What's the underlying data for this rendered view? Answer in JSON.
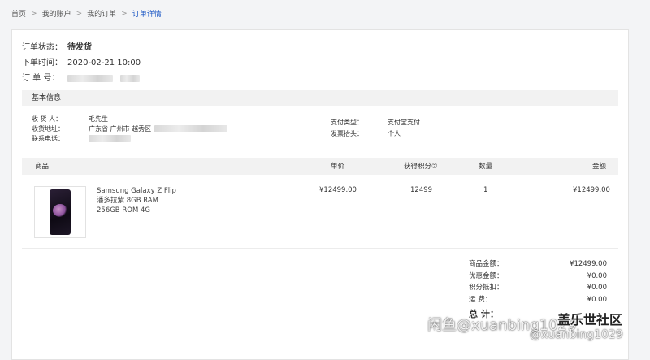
{
  "breadcrumb": {
    "items": [
      "首页",
      "我的账户",
      "我的订单"
    ],
    "current": "订单详情",
    "separator": ">"
  },
  "order": {
    "status_label": "订单状态：",
    "status_value": "待发货",
    "time_label": "下单时间：",
    "time_value": "2020-02-21 10:00",
    "number_label": "订 单 号："
  },
  "basic_info": {
    "title": "基本信息",
    "receiver_label": "收 货 人：",
    "receiver_value": "毛先生",
    "address_label": "收货地址：",
    "address_value": "广东省   广州市   越秀区",
    "phone_label": "联系电话：",
    "pay_type_label": "支付类型：",
    "pay_type_value": "支付宝支付",
    "invoice_label": "发票抬头：",
    "invoice_value": "个人"
  },
  "goods_table": {
    "headers": {
      "product": "商品",
      "price": "单价",
      "points": "获得积分⑦",
      "qty": "数量",
      "amount": "金额"
    },
    "item": {
      "name": "Samsung Galaxy Z Flip",
      "spec1": "潘多拉紫   8GB RAM",
      "spec2": "256GB ROM   4G",
      "price": "¥12499.00",
      "points": "12499",
      "qty": "1",
      "amount": "¥12499.00"
    }
  },
  "totals": {
    "goods_label": "商品金额：",
    "goods_value": "¥12499.00",
    "discount_label": "优惠金额：",
    "discount_value": "¥0.00",
    "points_label": "积分抵扣：",
    "points_value": "¥0.00",
    "shipping_label": "运     费：",
    "shipping_value": "¥0.00",
    "grand_label": "总    计："
  },
  "watermarks": {
    "line1": "闲鱼@xuanbing1029",
    "brand": "盖乐世社区",
    "line2": "@xuanbing1029"
  }
}
